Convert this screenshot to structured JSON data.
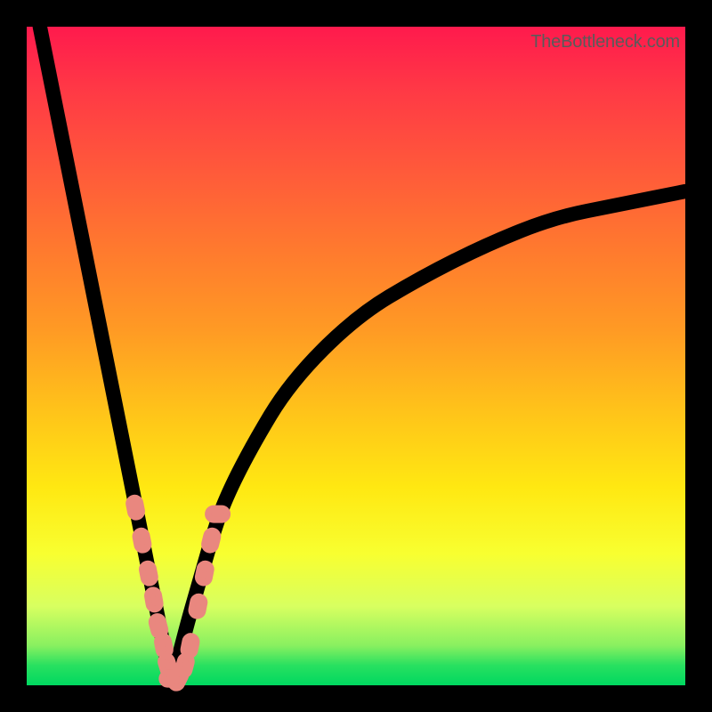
{
  "watermark": "TheBottleneck.com",
  "chart_data": {
    "type": "line",
    "title": "",
    "xlabel": "",
    "ylabel": "",
    "xlim": [
      0,
      100
    ],
    "ylim": [
      0,
      100
    ],
    "description": "V-shaped bottleneck curve over red→green vertical gradient. Minimum (optimal/green zone) sits at roughly x≈22 where y≈0. Left branch rises steeply toward y≈100 as x→0; right branch rises with decreasing slope toward y≈75 as x→100.",
    "series": [
      {
        "name": "left-branch",
        "x": [
          2,
          4,
          6,
          8,
          10,
          12,
          14,
          16,
          18,
          20,
          21,
          22
        ],
        "y": [
          100,
          90,
          80,
          70,
          60,
          50,
          40,
          30,
          20,
          10,
          5,
          0
        ]
      },
      {
        "name": "right-branch",
        "x": [
          22,
          24,
          26,
          28,
          30,
          34,
          40,
          50,
          60,
          70,
          80,
          90,
          100
        ],
        "y": [
          0,
          8,
          15,
          22,
          28,
          36,
          46,
          56,
          62,
          67,
          71,
          73,
          75
        ]
      }
    ],
    "markers": {
      "name": "highlighted-points",
      "comment": "pink/salmon blobs clustered near the bottom of the V",
      "points": [
        {
          "x": 16.5,
          "y": 27
        },
        {
          "x": 17.5,
          "y": 22
        },
        {
          "x": 18.5,
          "y": 17
        },
        {
          "x": 19.3,
          "y": 13
        },
        {
          "x": 20.0,
          "y": 9
        },
        {
          "x": 20.8,
          "y": 6
        },
        {
          "x": 21.4,
          "y": 3
        },
        {
          "x": 22.0,
          "y": 1
        },
        {
          "x": 23.0,
          "y": 1
        },
        {
          "x": 24.0,
          "y": 3
        },
        {
          "x": 24.8,
          "y": 6
        },
        {
          "x": 26.0,
          "y": 12
        },
        {
          "x": 27.0,
          "y": 17
        },
        {
          "x": 28.0,
          "y": 22
        },
        {
          "x": 29.0,
          "y": 26
        }
      ]
    }
  }
}
